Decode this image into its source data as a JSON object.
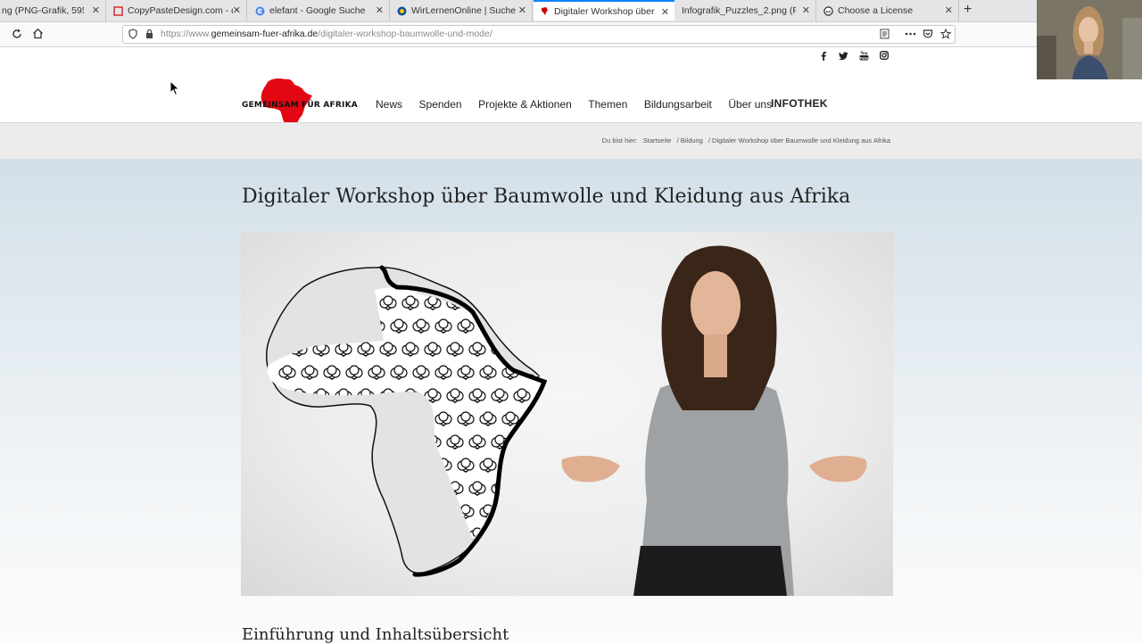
{
  "browser": {
    "tabs": [
      {
        "label": "ng (PNG-Grafik, 595 ×",
        "active": false
      },
      {
        "label": "CopyPasteDesign.com - qu",
        "active": false
      },
      {
        "label": "elefant - Google Suche",
        "active": false
      },
      {
        "label": "WirLernenOnline | Suche",
        "active": false
      },
      {
        "label": "Digitaler Workshop über B",
        "active": true
      },
      {
        "label": "Infografik_Puzzles_2.png (PNG",
        "active": false
      },
      {
        "label": "Choose a License",
        "active": false
      }
    ],
    "close_glyph": "✕",
    "new_tab_glyph": "+",
    "url_prefix": "https://www.",
    "url_domain": "gemeinsam-fuer-afrika.de",
    "url_path": "/digitaler-workshop-baumwolle-und-mode/",
    "url_full": "https://www.gemeinsam-fuer-afrika.de/digitaler-workshop-baumwolle-und-mode/"
  },
  "site": {
    "logo_text": "GEMEINSAM FÜR AFRIKA",
    "logo_color": "#e30613",
    "social_icons": [
      "facebook-icon",
      "twitter-icon",
      "youtube-icon",
      "instagram-icon"
    ],
    "nav": [
      "News",
      "Spenden",
      "Projekte & Aktionen",
      "Themen",
      "Bildungsarbeit",
      "Über uns"
    ],
    "infothek": "INFOTHEK",
    "breadcrumb": {
      "prefix": "Du bist hier:",
      "items": [
        "Startseite",
        "/ Bildung",
        "/ Digitaler Workshop über Baumwolle und Kleidung aus Afrika"
      ]
    }
  },
  "main": {
    "title": "Digitaler Workshop über Baumwolle und Kleidung aus Afrika",
    "subtitle": "Einführung und Inhaltsübersicht"
  }
}
